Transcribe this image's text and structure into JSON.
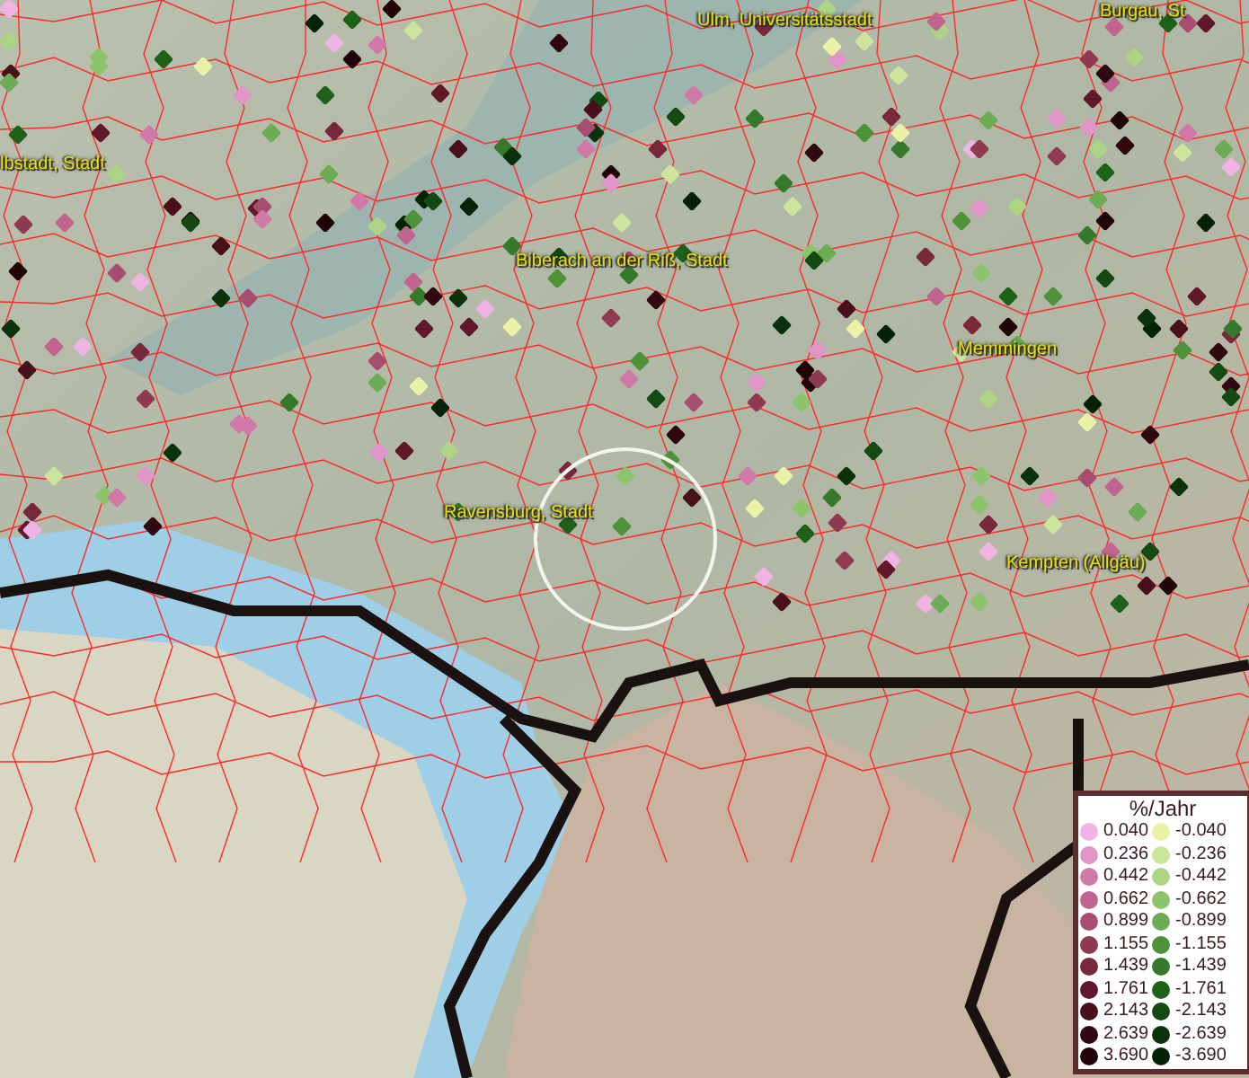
{
  "map": {
    "labels": [
      {
        "text": "Ulm, Universitätsstadt"
      },
      {
        "text": "Burgau, St"
      },
      {
        "text": "lbstadt, Stadt"
      },
      {
        "text": "Biberach an der Riß, Stadt"
      },
      {
        "text": "Memmingen"
      },
      {
        "text": "Ravensburg, Stadt"
      },
      {
        "text": "Kempten (Allgäu)"
      }
    ]
  },
  "legend": {
    "title": "%/Jahr",
    "columns": [
      {
        "items": [
          {
            "label": "0.040",
            "color": "#f0b4e4"
          },
          {
            "label": "0.236",
            "color": "#e094c8"
          },
          {
            "label": "0.442",
            "color": "#d078a8"
          },
          {
            "label": "0.662",
            "color": "#c06490"
          },
          {
            "label": "0.899",
            "color": "#a84c70"
          },
          {
            "label": "1.155",
            "color": "#903a52"
          },
          {
            "label": "1.439",
            "color": "#78283a"
          },
          {
            "label": "1.761",
            "color": "#60182a"
          },
          {
            "label": "2.143",
            "color": "#48101a"
          },
          {
            "label": "2.639",
            "color": "#300810"
          },
          {
            "label": "3.690",
            "color": "#200408"
          }
        ]
      },
      {
        "items": [
          {
            "label": "-0.040",
            "color": "#eaf2a8"
          },
          {
            "label": "-0.236",
            "color": "#cce49c"
          },
          {
            "label": "-0.442",
            "color": "#acd484"
          },
          {
            "label": "-0.662",
            "color": "#8cc46c"
          },
          {
            "label": "-0.899",
            "color": "#6cac54"
          },
          {
            "label": "-1.155",
            "color": "#4e923a"
          },
          {
            "label": "-1.439",
            "color": "#347a2a"
          },
          {
            "label": "-1.761",
            "color": "#1e621a"
          },
          {
            "label": "-2.143",
            "color": "#124a12"
          },
          {
            "label": "-2.639",
            "color": "#0a320a"
          },
          {
            "label": "-3.690",
            "color": "#062206"
          }
        ]
      }
    ]
  }
}
